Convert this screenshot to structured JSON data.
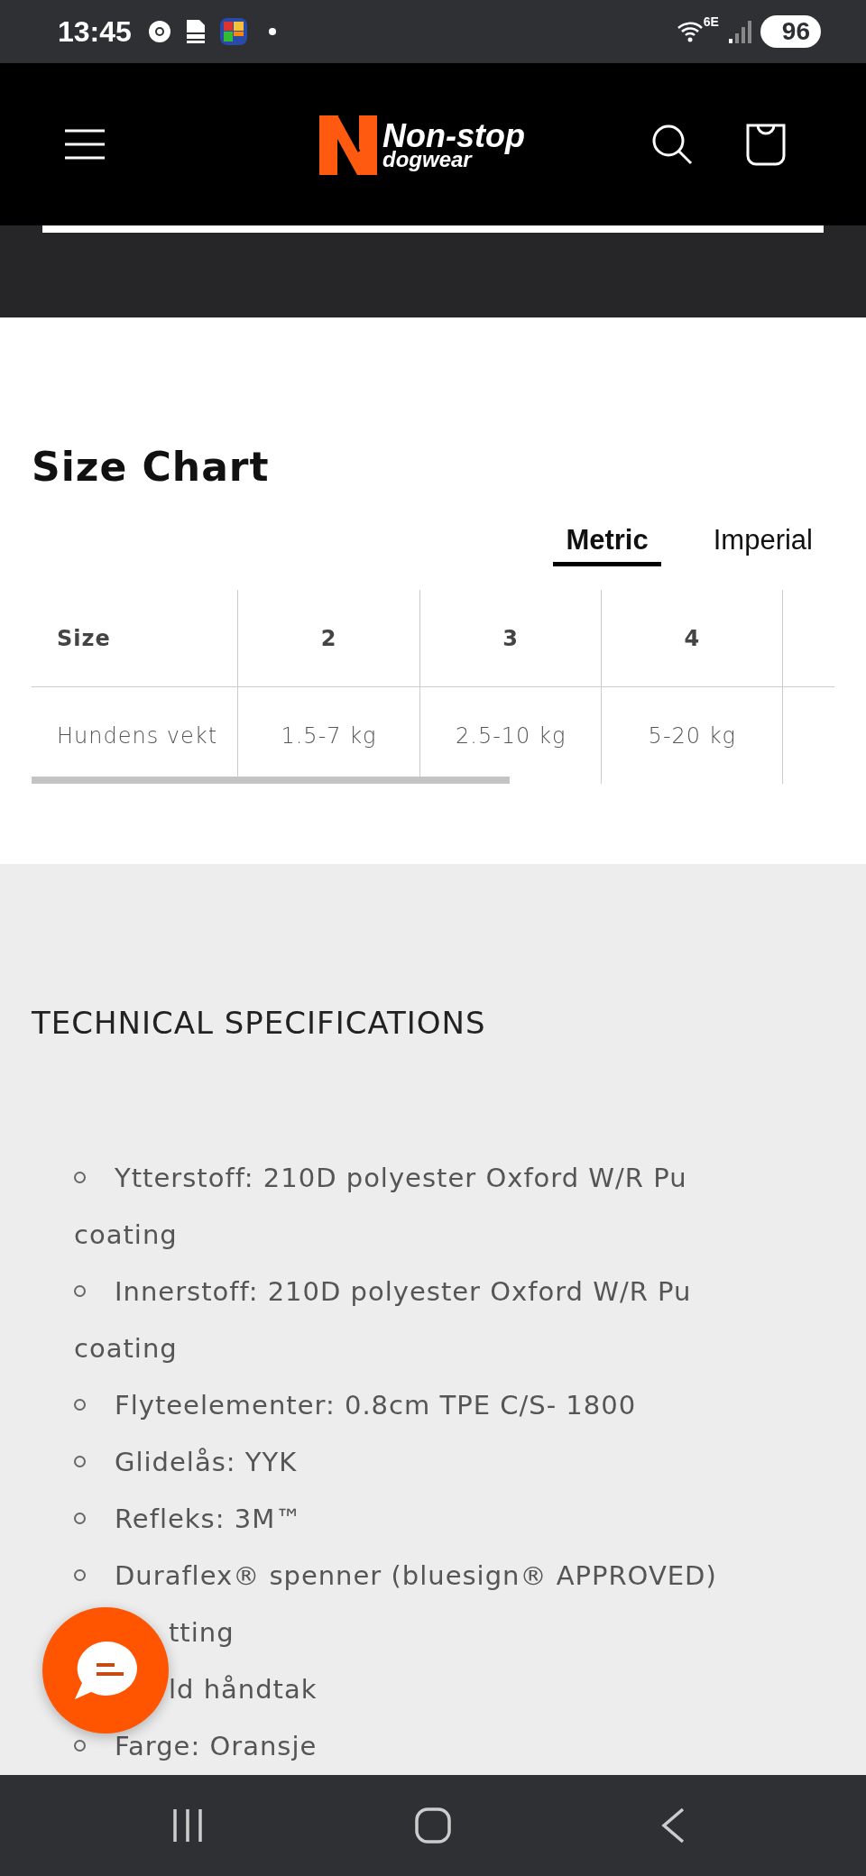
{
  "status_bar": {
    "time": "13:45",
    "network": "6E",
    "battery": "96"
  },
  "header": {
    "logo_name": "Non-stop",
    "logo_sub": "dogwear"
  },
  "size_chart": {
    "title": "Size Chart",
    "tabs": [
      {
        "label": "Metric",
        "selected": true
      },
      {
        "label": "Imperial",
        "selected": false
      }
    ],
    "columns": [
      "Size",
      "2",
      "3",
      "4"
    ],
    "rows": [
      [
        "Hundens vekt",
        "1.5-7 kg",
        "2.5-10 kg",
        "5-20 kg"
      ]
    ]
  },
  "specs": {
    "title": "TECHNICAL SPECIFICATIONS",
    "lines": [
      {
        "kind": "bullet",
        "text": "Ytterstoff: 210D polyester Oxford W/R Pu"
      },
      {
        "kind": "wrap",
        "text": "coating"
      },
      {
        "kind": "bullet",
        "text": "Innerstoff: 210D polyester Oxford W/R Pu"
      },
      {
        "kind": "wrap",
        "text": "coating"
      },
      {
        "kind": "bullet",
        "text": "Flyteelementer: 0.8cm TPE C/S- 1800"
      },
      {
        "kind": "bullet",
        "text": "Glidelås: YYK"
      },
      {
        "kind": "bullet",
        "text": "Refleks: 3M™"
      },
      {
        "kind": "bullet",
        "text": "Duraflex® spenner (bluesign® APPROVED)"
      },
      {
        "kind": "covered",
        "text": "tting"
      },
      {
        "kind": "covered",
        "text": "ld håndtak"
      },
      {
        "kind": "bullet",
        "text": "Farge: Oransje"
      }
    ]
  }
}
